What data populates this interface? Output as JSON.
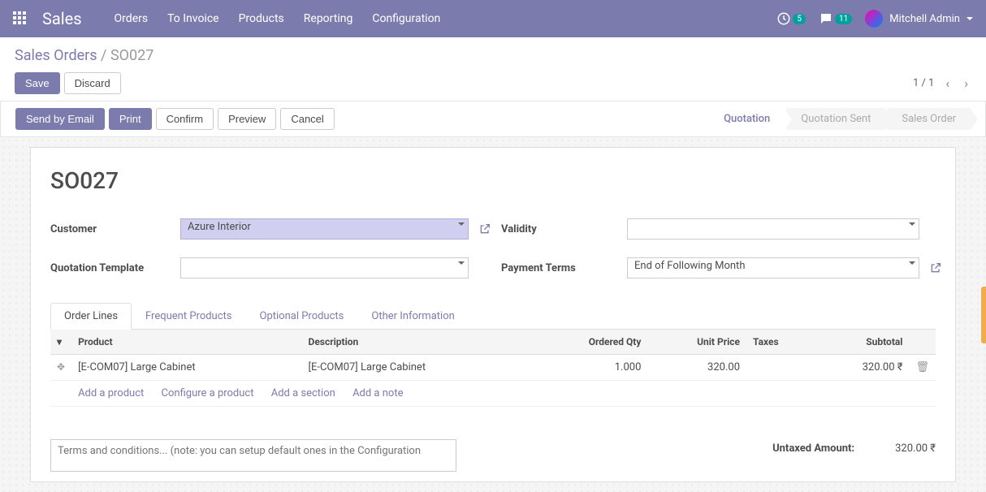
{
  "nav": {
    "brand": "Sales",
    "menu": [
      "Orders",
      "To Invoice",
      "Products",
      "Reporting",
      "Configuration"
    ],
    "activity_count": "5",
    "msg_count": "11",
    "user": "Mitchell Admin"
  },
  "breadcrumb": {
    "root": "Sales Orders",
    "sep": "/",
    "current": "SO027"
  },
  "buttons": {
    "save": "Save",
    "discard": "Discard"
  },
  "pager": {
    "text": "1 / 1"
  },
  "actions": {
    "send_email": "Send by Email",
    "print": "Print",
    "confirm": "Confirm",
    "preview": "Preview",
    "cancel": "Cancel"
  },
  "status": {
    "quotation": "Quotation",
    "quotation_sent": "Quotation Sent",
    "sales_order": "Sales Order"
  },
  "sheet": {
    "title": "SO027",
    "labels": {
      "customer": "Customer",
      "quotation_template": "Quotation Template",
      "validity": "Validity",
      "payment_terms": "Payment Terms"
    },
    "values": {
      "customer": "Azure Interior",
      "quotation_template": "",
      "validity": "",
      "payment_terms": "End of Following Month"
    }
  },
  "tabs": {
    "order_lines": "Order Lines",
    "frequent": "Frequent Products",
    "optional": "Optional Products",
    "other": "Other Information"
  },
  "cols": {
    "product": "Product",
    "description": "Description",
    "ordered_qty": "Ordered Qty",
    "unit_price": "Unit Price",
    "taxes": "Taxes",
    "subtotal": "Subtotal"
  },
  "lines": [
    {
      "product": "[E-COM07] Large Cabinet",
      "description": "[E-COM07] Large Cabinet",
      "qty": "1.000",
      "price": "320.00",
      "taxes": "",
      "subtotal": "320.00 ₹"
    }
  ],
  "adders": {
    "add_product": "Add a product",
    "configure": "Configure a product",
    "add_section": "Add a section",
    "add_note": "Add a note"
  },
  "terms_placeholder": "Terms and conditions... (note: you can setup default ones in the Configuration",
  "totals": {
    "untaxed_label": "Untaxed Amount:",
    "untaxed_value": "320.00 ₹"
  }
}
